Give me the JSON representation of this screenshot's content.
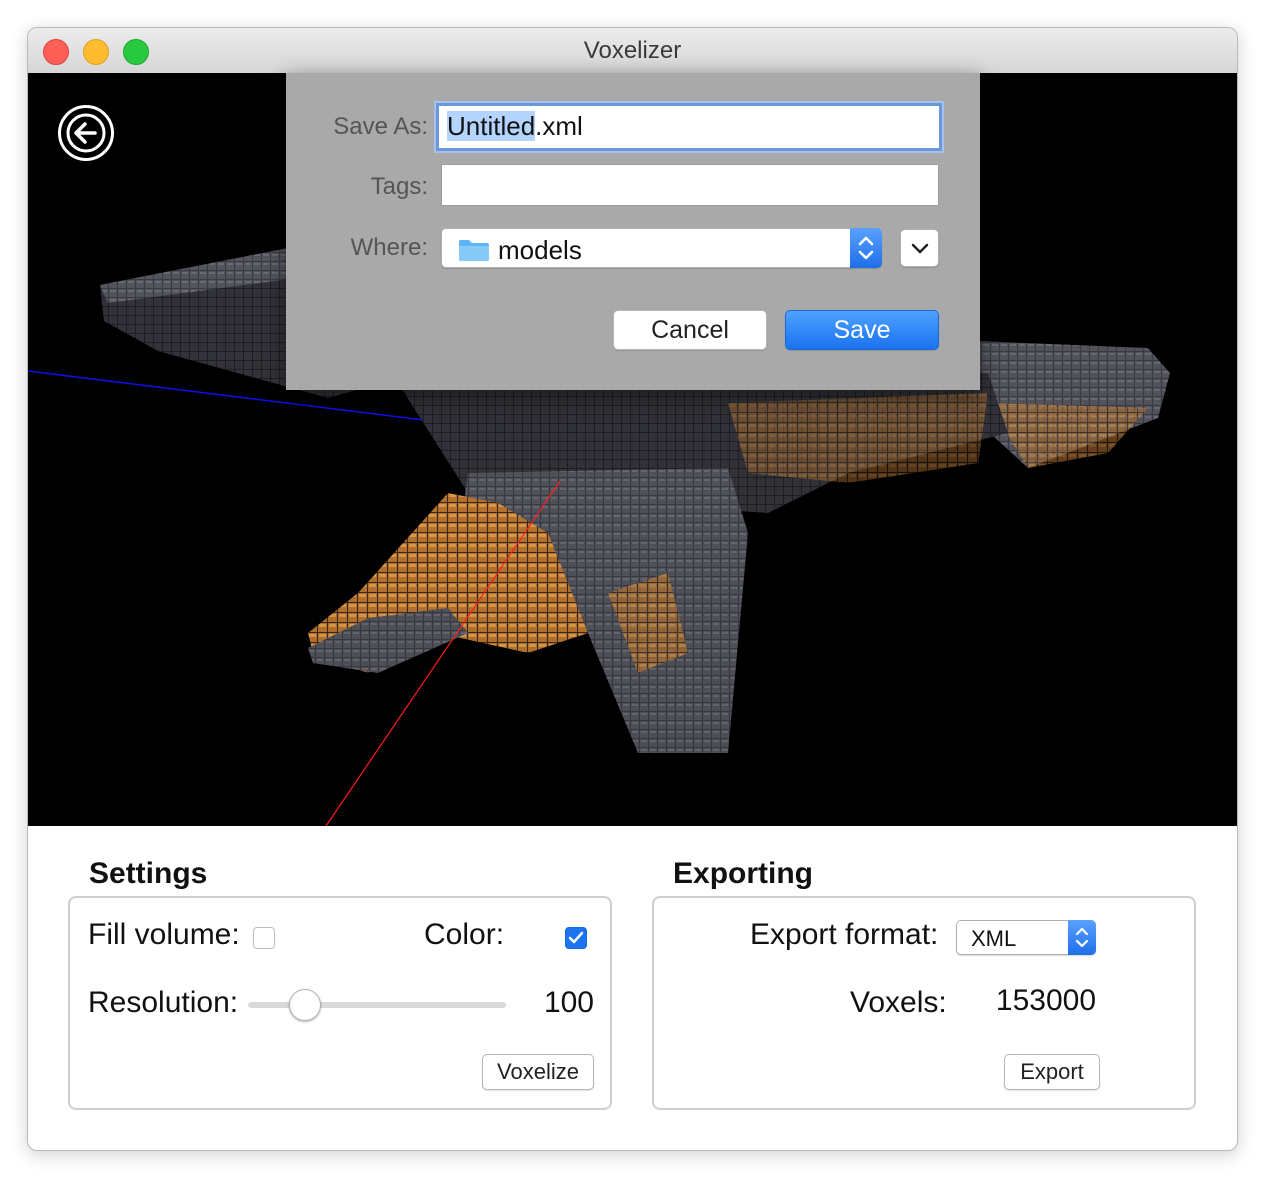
{
  "window": {
    "title": "Voxelizer"
  },
  "dialog": {
    "save_as_label": "Save As:",
    "filename_selected": "Untitled",
    "filename_ext": ".xml",
    "tags_label": "Tags:",
    "tags_value": "",
    "where_label": "Where:",
    "where_value": "models",
    "cancel_label": "Cancel",
    "save_label": "Save"
  },
  "settings": {
    "title": "Settings",
    "fill_volume_label": "Fill volume:",
    "fill_volume_checked": false,
    "color_label": "Color:",
    "color_checked": true,
    "resolution_label": "Resolution:",
    "resolution_value": "100",
    "resolution_fraction": 0.22,
    "voxelize_label": "Voxelize"
  },
  "exporting": {
    "title": "Exporting",
    "format_label": "Export format:",
    "format_value": "XML",
    "voxels_label": "Voxels:",
    "voxels_value": "153000",
    "export_label": "Export"
  },
  "colors": {
    "accent": "#1d74f0",
    "axis_x": "#ff0000",
    "axis_z": "#1010ff"
  },
  "icons": {
    "back": "arrow-left-circle-icon",
    "folder": "folder-icon"
  }
}
